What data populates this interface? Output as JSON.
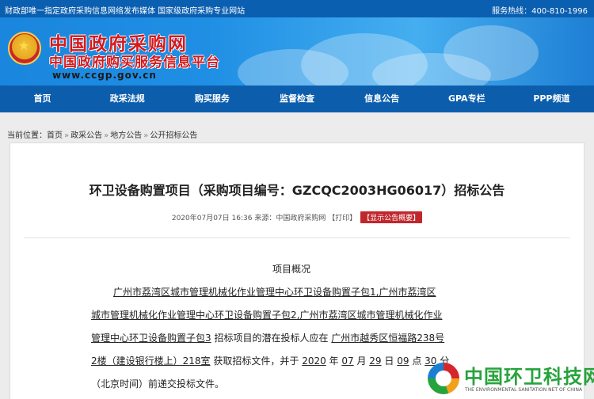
{
  "topbar": {
    "notice": "财政部唯一指定政府采购信息网络发布媒体 国家级政府采购专业网站",
    "hotline": "服务热线：400-810-1996"
  },
  "header": {
    "title": "中国政府采购网",
    "subtitle": "中国政府购买服务信息平台",
    "url": "www.ccgp.gov.cn"
  },
  "nav": {
    "items": [
      "首页",
      "政采法规",
      "购买服务",
      "监督检查",
      "信息公告",
      "GPA专栏",
      "PPP频道"
    ]
  },
  "breadcrumb": {
    "label": "当前位置：",
    "items": [
      "首页",
      "政采公告",
      "地方公告",
      "公开招标公告"
    ],
    "separator": "»"
  },
  "article": {
    "title": "环卫设备购置项目（采购项目编号：GZCQC2003HG06017）招标公告",
    "date": "2020年07月07日 16:36",
    "source_label": "来源：",
    "source": "中国政府采购网",
    "print": "【打印】",
    "summary_button": "【显示公告概要】",
    "section_title": "项目概况",
    "body": {
      "l1a": "广州市荔湾区城市管理机械化作业管理中心环卫设备购置子包1,广州市荔湾区",
      "l2a": "城市管理机械化作业管理中心环卫设备购置子包2,广州市荔湾区城市管理机械化作业",
      "l3a": "管理中心环卫设备购置子包3",
      "l3b": " 招标项目的潜在投标人应在 ",
      "l3c": "广州市越秀区恒福路238号",
      "l4a": "2楼（建设银行楼上）218室",
      "l4b": " 获取招标文件，并于 ",
      "l4c": "2020",
      "l4d": " 年 ",
      "l4e": "07",
      "l4f": " 月 ",
      "l4g": "29",
      "l4h": " 日 ",
      "l4i": "09",
      "l4j": " 点 ",
      "l4k": "30",
      "l4l": " 分",
      "l5a": "（北京时间）前递交投标文件。"
    }
  },
  "watermark": {
    "title": "中国环卫科技网",
    "subtitle": "THE ENVIRONMENTAL SANITATION NET OF CHINA"
  },
  "colors": {
    "topbar": "#0b5fb0",
    "nav": "#0c5ead",
    "logo_red": "#d5191c",
    "summary_button": "#c0272d",
    "watermark_green": "#27a33c"
  }
}
